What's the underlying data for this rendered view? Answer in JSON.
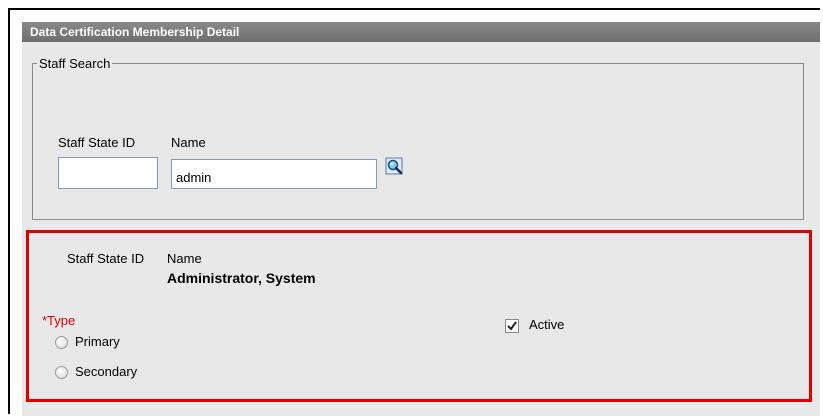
{
  "header": {
    "title": "Data Certification Membership Detail"
  },
  "staff_search": {
    "legend": "Staff Search",
    "staff_state_id_label": "Staff State ID",
    "name_label": "Name",
    "staff_state_id_value": "",
    "name_value": "admin",
    "search_icon": "magnifier-icon"
  },
  "result": {
    "staff_state_id_label": "Staff State ID",
    "name_label": "Name",
    "name_value": "Administrator, System",
    "type_label": "*Type",
    "type_options": [
      "Primary",
      "Secondary"
    ],
    "active_label": "Active",
    "active_checked": true
  },
  "colors": {
    "highlight_border": "#e00000",
    "required_label": "#e00000",
    "header_bg": "#7a7a7a"
  }
}
